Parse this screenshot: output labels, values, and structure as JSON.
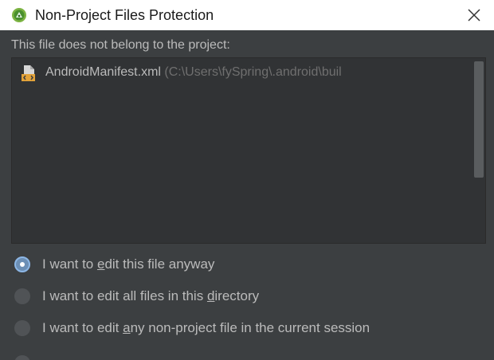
{
  "dialog": {
    "title": "Non-Project Files Protection",
    "close_icon": "close-icon",
    "app_icon": "android-studio-icon"
  },
  "message": "This file does not belong to the project:",
  "file_list": {
    "items": [
      {
        "name": "AndroidManifest.xml",
        "path": "(C:\\Users\\fySpring\\.android\\buil",
        "icon": "xml-file-icon"
      }
    ]
  },
  "options": [
    {
      "before": "I want to ",
      "mnemonic": "e",
      "after": "dit this file anyway",
      "selected": true
    },
    {
      "before": "I want to edit all files in this ",
      "mnemonic": "d",
      "after": "irectory",
      "selected": false
    },
    {
      "before": "I want to edit ",
      "mnemonic": "a",
      "after": "ny non-project file in the current session",
      "selected": false
    }
  ],
  "colors": {
    "dialog_bg": "#3c3f41",
    "list_bg": "#313335",
    "text": "#bbbbbb",
    "path_text": "#6f6f6f",
    "selected_radio": "#6c8fb5"
  }
}
